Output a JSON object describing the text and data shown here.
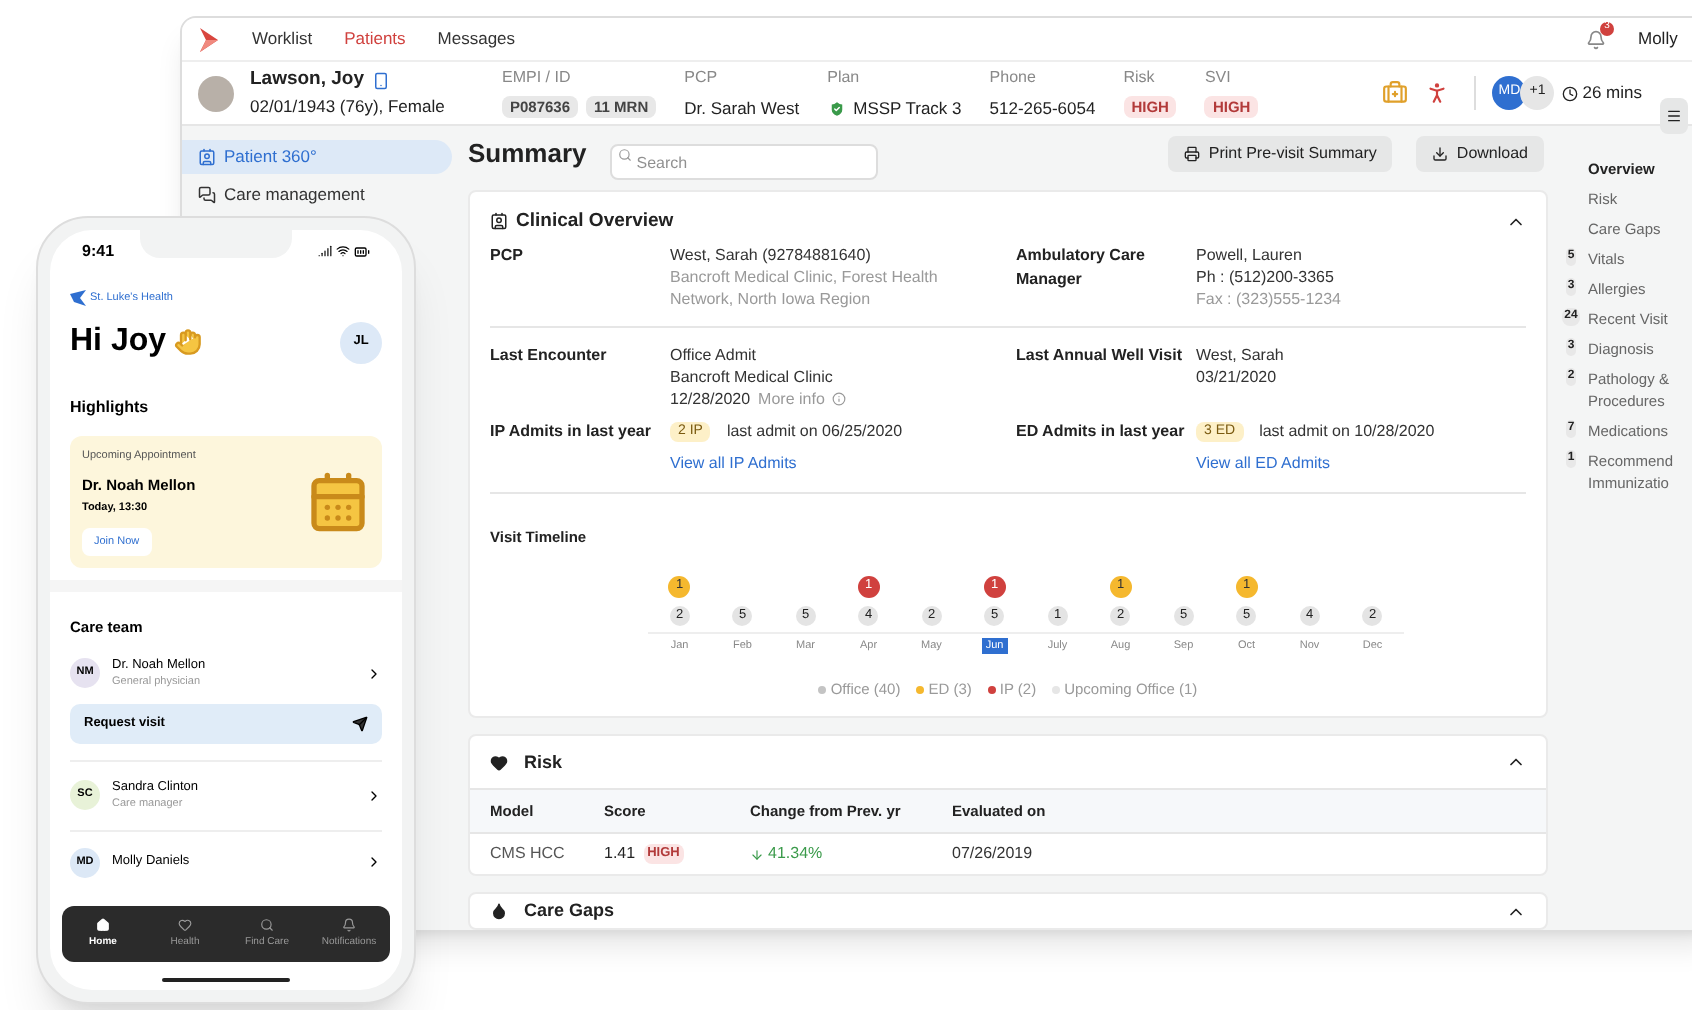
{
  "app": {
    "nav": [
      {
        "label": "Worklist",
        "selected": false
      },
      {
        "label": "Patients",
        "selected": true
      },
      {
        "label": "Messages",
        "selected": false
      }
    ],
    "notification_count": "3",
    "user": "Molly"
  },
  "patient": {
    "name": "Lawson, Joy",
    "details": "02/01/1943 (76y), Female",
    "fields": [
      {
        "label": "EMPI / ID",
        "kind": "ids",
        "values": [
          "P087636",
          "11 MRN"
        ]
      },
      {
        "label": "PCP",
        "kind": "text",
        "value": "Dr. Sarah West"
      },
      {
        "label": "Plan",
        "kind": "verified",
        "value": "MSSP Track 3"
      },
      {
        "label": "Phone",
        "kind": "text",
        "value": "512-265-6054"
      },
      {
        "label": "Risk",
        "kind": "flag",
        "value": "HIGH"
      },
      {
        "label": "SVI",
        "kind": "flag",
        "value": "HIGH"
      }
    ],
    "team_initials": "MD",
    "team_more": "+1",
    "timer": "26 mins"
  },
  "sidebar": [
    {
      "label": "Patient 360°",
      "selected": true
    },
    {
      "label": "Care management",
      "selected": false
    }
  ],
  "summary": {
    "title": "Summary",
    "search_placeholder": "Search",
    "print": "Print Pre-visit Summary",
    "download": "Download"
  },
  "clinical_overview": {
    "title": "Clinical Overview",
    "expanded": true,
    "contacts": [
      {
        "label": "PCP",
        "lines": [
          {
            "text": "West, Sarah (92784881640)",
            "muted": false
          },
          {
            "text": "Bancroft Medical Clinic, Forest Health Network, North Iowa Region",
            "muted": true
          }
        ]
      },
      {
        "label": "Ambulatory Care Manager",
        "lines": [
          {
            "text": "Powell, Lauren",
            "muted": false
          },
          {
            "text": "Ph : (512)200-3365",
            "muted": false
          },
          {
            "text": "Fax : (323)555-1234",
            "muted": true
          }
        ]
      }
    ],
    "last_encounter": {
      "label": "Last Encounter",
      "lines": [
        "Office Admit",
        "Bancroft Medical Clinic"
      ],
      "date": "12/28/2020",
      "more": "More info"
    },
    "last_well_visit": {
      "label": "Last Annual Well Visit",
      "lines": [
        "West, Sarah",
        "03/21/2020"
      ]
    },
    "admits": [
      {
        "label": "IP Admits in last year",
        "badge": "2 IP",
        "note": "last admit on 06/25/2020",
        "link": "View all IP Admits"
      },
      {
        "label": "ED Admits in last year",
        "badge": "3 ED",
        "note": "last admit on 10/28/2020",
        "link": "View all ED Admits"
      }
    ],
    "timeline": {
      "title": "Visit Timeline",
      "months": [
        {
          "label": "Jan",
          "office": "2",
          "event": {
            "kind": "ed",
            "count": "1"
          },
          "selected": false
        },
        {
          "label": "Feb",
          "office": "5",
          "selected": false
        },
        {
          "label": "Mar",
          "office": "5",
          "selected": false
        },
        {
          "label": "Apr",
          "office": "4",
          "event": {
            "kind": "ip",
            "count": "1"
          },
          "selected": false
        },
        {
          "label": "May",
          "office": "2",
          "selected": false
        },
        {
          "label": "Jun",
          "office": "5",
          "event": {
            "kind": "ip",
            "count": "1"
          },
          "selected": true
        },
        {
          "label": "July",
          "office": "1",
          "selected": false
        },
        {
          "label": "Aug",
          "office": "2",
          "event": {
            "kind": "ed",
            "count": "1"
          },
          "selected": false
        },
        {
          "label": "Sep",
          "office": "5",
          "selected": false
        },
        {
          "label": "Oct",
          "office": "5",
          "event": {
            "kind": "ed",
            "count": "1"
          },
          "selected": false
        },
        {
          "label": "Nov",
          "office": "4",
          "selected": false
        },
        {
          "label": "Dec",
          "office": "2",
          "selected": false
        }
      ],
      "legend": [
        {
          "label": "Office (40)",
          "color": "#c4c4c4"
        },
        {
          "label": "ED (3)",
          "color": "#f5b82e"
        },
        {
          "label": "IP (2)",
          "color": "#d0413e"
        },
        {
          "label": "Upcoming Office (1)",
          "color": "#e6e6e6"
        }
      ]
    }
  },
  "risk": {
    "title": "Risk",
    "expanded": true,
    "columns": [
      "Model",
      "Score",
      "Change from Prev. yr",
      "Evaluated on"
    ],
    "rows": [
      {
        "model": "CMS HCC",
        "score": "1.41",
        "flag": "HIGH",
        "change": "41.34%",
        "decreased": true,
        "evaluated": "07/26/2019"
      }
    ]
  },
  "care_gaps": {
    "title": "Care Gaps",
    "expanded": true
  },
  "section_nav": [
    {
      "label": "Overview",
      "selected": true
    },
    {
      "label": "Risk",
      "selected": false
    },
    {
      "label": "Care Gaps",
      "selected": false
    },
    {
      "count": "5",
      "label": "Vitals",
      "selected": false
    },
    {
      "count": "3",
      "label": "Allergies",
      "selected": false
    },
    {
      "count": "24",
      "label": "Recent Visit",
      "selected": false
    },
    {
      "count": "3",
      "label": "Diagnosis",
      "selected": false
    },
    {
      "count": "2",
      "label": "Pathology & Procedures",
      "selected": false
    },
    {
      "count": "7",
      "label": "Medications",
      "selected": false
    },
    {
      "count": "1",
      "label": "Recommend Immunizatio",
      "selected": false
    }
  ],
  "phone": {
    "time": "9:41",
    "brand": "St. Luke's Health",
    "greeting": "Hi Joy",
    "initials": "JL",
    "highlights_title": "Highlights",
    "appointment": {
      "label": "Upcoming Appointment",
      "doctor": "Dr. Noah Mellon",
      "time": "Today, 13:30",
      "action": "Join Now"
    },
    "care_team_title": "Care team",
    "care_team": [
      {
        "initials": "NM",
        "name": "Dr. Noah Mellon",
        "role": "General physician",
        "color": "#e6e2f0",
        "action": "Request visit"
      },
      {
        "initials": "SC",
        "name": "Sandra Clinton",
        "role": "Care manager",
        "color": "#e8f2d8"
      },
      {
        "initials": "MD",
        "name": "Molly Daniels",
        "color": "#dce8f6"
      }
    ],
    "tabs": [
      {
        "label": "Home",
        "selected": true
      },
      {
        "label": "Health",
        "selected": false
      },
      {
        "label": "Find Care",
        "selected": false
      },
      {
        "label": "Notifications",
        "selected": false
      }
    ]
  }
}
